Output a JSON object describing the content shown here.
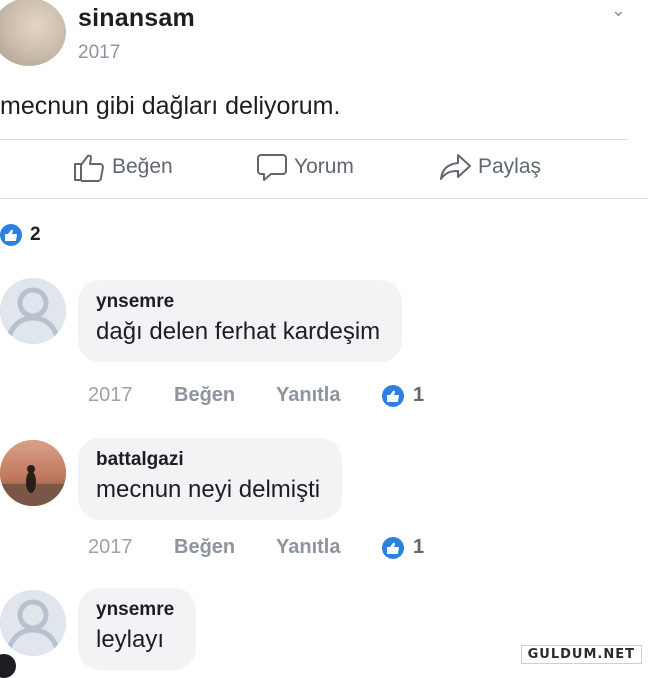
{
  "post": {
    "author": "sinansam",
    "year": "2017",
    "text": "mecnun gibi dağları deliyorum."
  },
  "actions": {
    "like": "Beğen",
    "comment": "Yorum",
    "share": "Paylaş"
  },
  "reactions": {
    "count": "2"
  },
  "comments": [
    {
      "author": "ynsemre",
      "text": "dağı delen ferhat kardeşim",
      "year": "2017",
      "like_label": "Beğen",
      "reply_label": "Yanıtla",
      "like_count": "1",
      "avatar": "default-profile-icon"
    },
    {
      "author": "battalgazi",
      "text": "mecnun neyi delmişti",
      "year": "2017",
      "like_label": "Beğen",
      "reply_label": "Yanıtla",
      "like_count": "1",
      "avatar": "sunset-photo"
    },
    {
      "author": "ynsemre",
      "text": "leylayı",
      "avatar": "default-profile-icon"
    }
  ],
  "watermark": "GULDUM.NET",
  "colors": {
    "accent": "#2d7fe0",
    "bubble": "#f2f3f5",
    "muted": "#8d949e"
  }
}
